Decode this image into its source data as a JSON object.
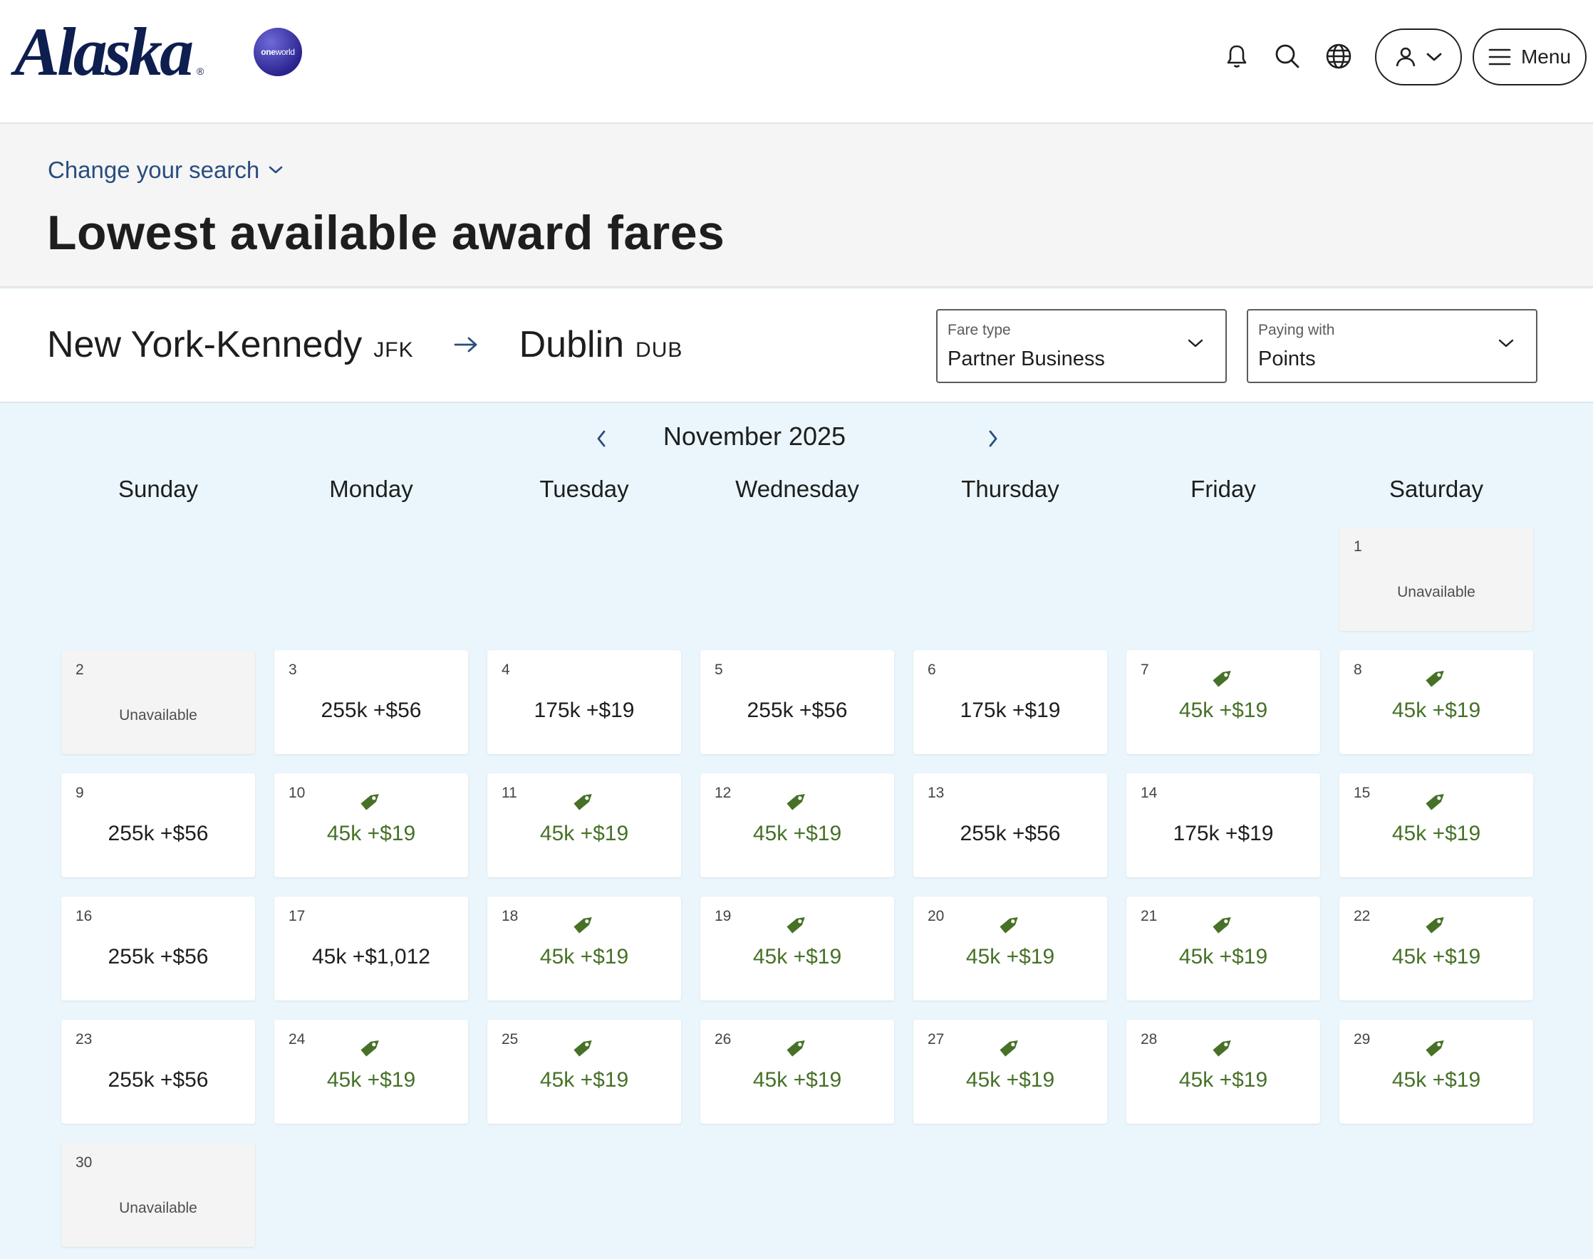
{
  "header": {
    "logo_text": "Alaska",
    "logo_reg": "®",
    "oneworld_one": "one",
    "oneworld_world": "world",
    "menu_label": "Menu"
  },
  "search": {
    "change_label": "Change your search",
    "title": "Lowest available award fares"
  },
  "route": {
    "origin_city": "New York-Kennedy",
    "origin_code": "JFK",
    "dest_city": "Dublin",
    "dest_code": "DUB"
  },
  "fare_type": {
    "label": "Fare type",
    "value": "Partner Business"
  },
  "paying_with": {
    "label": "Paying with",
    "value": "Points"
  },
  "calendar": {
    "month": "November 2025",
    "weekdays": [
      "Sunday",
      "Monday",
      "Tuesday",
      "Wednesday",
      "Thursday",
      "Friday",
      "Saturday"
    ],
    "leading_blanks": 6,
    "unavailable_text": "Unavailable",
    "days": [
      {
        "day": "1",
        "status": "unavailable"
      },
      {
        "day": "2",
        "status": "unavailable"
      },
      {
        "day": "3",
        "price": "255k +$56",
        "deal": false
      },
      {
        "day": "4",
        "price": "175k +$19",
        "deal": false
      },
      {
        "day": "5",
        "price": "255k +$56",
        "deal": false
      },
      {
        "day": "6",
        "price": "175k +$19",
        "deal": false
      },
      {
        "day": "7",
        "price": "45k +$19",
        "deal": true
      },
      {
        "day": "8",
        "price": "45k +$19",
        "deal": true
      },
      {
        "day": "9",
        "price": "255k +$56",
        "deal": false
      },
      {
        "day": "10",
        "price": "45k +$19",
        "deal": true
      },
      {
        "day": "11",
        "price": "45k +$19",
        "deal": true
      },
      {
        "day": "12",
        "price": "45k +$19",
        "deal": true
      },
      {
        "day": "13",
        "price": "255k +$56",
        "deal": false
      },
      {
        "day": "14",
        "price": "175k +$19",
        "deal": false
      },
      {
        "day": "15",
        "price": "45k +$19",
        "deal": true
      },
      {
        "day": "16",
        "price": "255k +$56",
        "deal": false
      },
      {
        "day": "17",
        "price": "45k +$1,012",
        "deal": false
      },
      {
        "day": "18",
        "price": "45k +$19",
        "deal": true
      },
      {
        "day": "19",
        "price": "45k +$19",
        "deal": true
      },
      {
        "day": "20",
        "price": "45k +$19",
        "deal": true
      },
      {
        "day": "21",
        "price": "45k +$19",
        "deal": true
      },
      {
        "day": "22",
        "price": "45k +$19",
        "deal": true
      },
      {
        "day": "23",
        "price": "255k +$56",
        "deal": false
      },
      {
        "day": "24",
        "price": "45k +$19",
        "deal": true
      },
      {
        "day": "25",
        "price": "45k +$19",
        "deal": true
      },
      {
        "day": "26",
        "price": "45k +$19",
        "deal": true
      },
      {
        "day": "27",
        "price": "45k +$19",
        "deal": true
      },
      {
        "day": "28",
        "price": "45k +$19",
        "deal": true
      },
      {
        "day": "29",
        "price": "45k +$19",
        "deal": true
      },
      {
        "day": "30",
        "status": "unavailable"
      }
    ]
  },
  "colors": {
    "brand_navy": "#0e1e4f",
    "link_blue": "#2a4d7d",
    "deal_green": "#467127",
    "calendar_bg": "#eaf6fb"
  },
  "icons": {
    "bell": "bell-icon",
    "search": "search-icon",
    "globe": "globe-icon",
    "account": "user-icon",
    "menu": "hamburger-icon",
    "deal": "price-tag-icon"
  }
}
